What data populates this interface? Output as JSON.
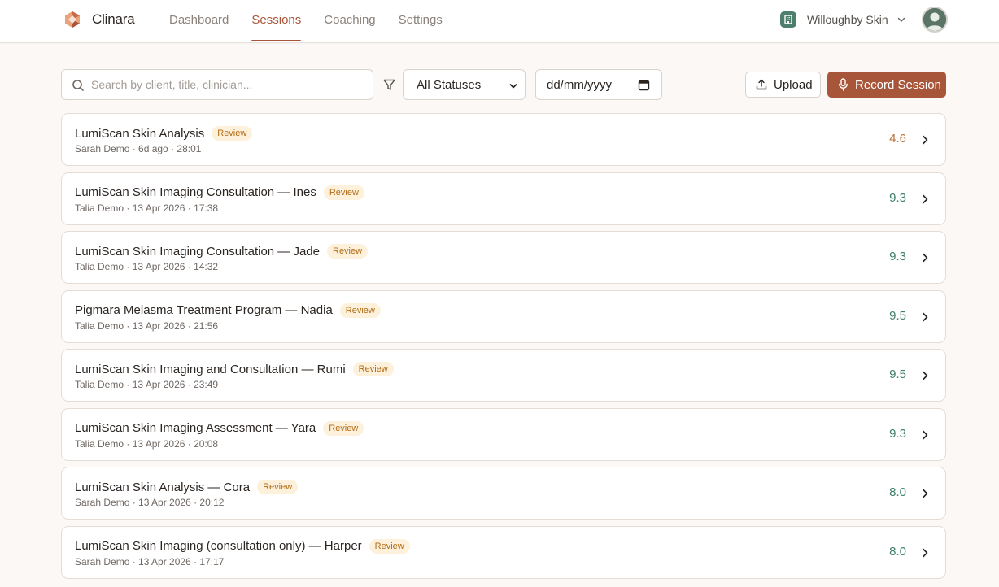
{
  "header": {
    "brand": "Clinara",
    "nav": [
      {
        "label": "Dashboard"
      },
      {
        "label": "Sessions",
        "active": true
      },
      {
        "label": "Coaching"
      },
      {
        "label": "Settings"
      }
    ],
    "org_name": "Willoughby Skin",
    "icons": {
      "logo": "clinara-logo-icon",
      "org": "building-icon",
      "avatar": "user-avatar-icon"
    }
  },
  "toolbar": {
    "search_placeholder": "Search by client, title, clinician...",
    "status_selected": "All Statuses",
    "date_placeholder": "dd/mm/yyyy",
    "upload_label": "Upload",
    "record_label": "Record Session"
  },
  "sessions": [
    {
      "title": "LumiScan Skin Analysis",
      "badge": "Review",
      "meta": "Sarah Demo · 6d ago · 28:01",
      "score": "4.6",
      "score_level": "low"
    },
    {
      "title": "LumiScan Skin Imaging Consultation — Ines",
      "badge": "Review",
      "meta": "Talia Demo · 13 Apr 2026 · 17:38",
      "score": "9.3",
      "score_level": "high"
    },
    {
      "title": "LumiScan Skin Imaging Consultation — Jade",
      "badge": "Review",
      "meta": "Talia Demo · 13 Apr 2026 · 14:32",
      "score": "9.3",
      "score_level": "high"
    },
    {
      "title": "Pigmara Melasma Treatment Program — Nadia",
      "badge": "Review",
      "meta": "Talia Demo · 13 Apr 2026 · 21:56",
      "score": "9.5",
      "score_level": "high"
    },
    {
      "title": "LumiScan Skin Imaging and Consultation — Rumi",
      "badge": "Review",
      "meta": "Talia Demo · 13 Apr 2026 · 23:49",
      "score": "9.5",
      "score_level": "high"
    },
    {
      "title": "LumiScan Skin Imaging Assessment — Yara",
      "badge": "Review",
      "meta": "Talia Demo · 13 Apr 2026 · 20:08",
      "score": "9.3",
      "score_level": "high"
    },
    {
      "title": "LumiScan Skin Analysis — Cora",
      "badge": "Review",
      "meta": "Sarah Demo · 13 Apr 2026 · 20:12",
      "score": "8.0",
      "score_level": "high"
    },
    {
      "title": "LumiScan Skin Imaging (consultation only) — Harper",
      "badge": "Review",
      "meta": "Sarah Demo · 13 Apr 2026 · 17:17",
      "score": "8.0",
      "score_level": "high"
    }
  ],
  "colors": {
    "accent": "#a8563a",
    "score_high": "#3e7d6b",
    "score_low": "#c0703c",
    "badge_bg": "#fdf1dc",
    "badge_text": "#b26a12",
    "page_bg": "#fbf8f5"
  }
}
